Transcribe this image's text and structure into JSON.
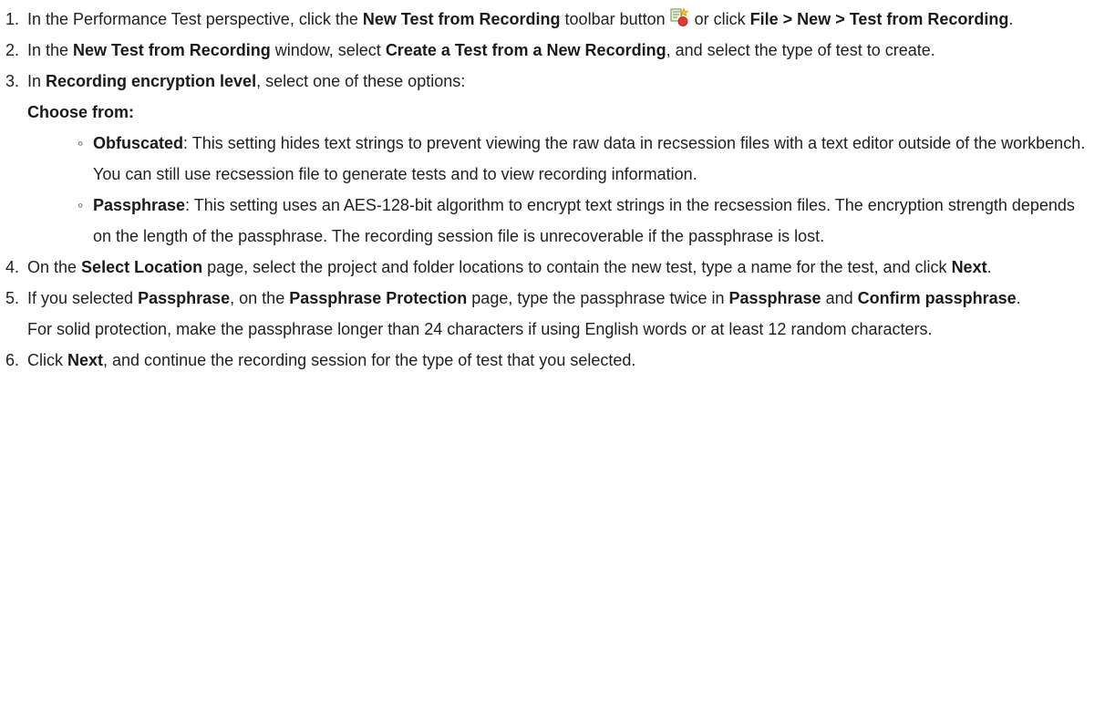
{
  "steps": [
    {
      "num": "1.",
      "a": "In the Performance Test perspective, click the ",
      "b1": "New Test from Recording",
      "c": " toolbar button ",
      "icon": "new-test-from-recording-icon",
      "d": " or click ",
      "b2": "File > New > Test from Recording",
      "e": "."
    },
    {
      "num": "2.",
      "a": "In the ",
      "b1": "New Test from Recording",
      "c": " window, select ",
      "b2": "Create a Test from a New Recording",
      "d": ", and select the type of test to create."
    },
    {
      "num": "3.",
      "a": "In ",
      "b1": "Recording encryption level",
      "c": ", select one of these options:",
      "choose": "Choose from:",
      "options": [
        {
          "term": "Obfuscated",
          "text": ": This setting hides text strings to prevent viewing the raw data in recsession files with a text editor outside of the workbench. You can still use recsession file to generate tests and to view recording information."
        },
        {
          "term": "Passphrase",
          "text": ": This setting uses an AES-128-bit algorithm to encrypt text strings in the recsession files. The encryption strength depends on the length of the passphrase. The recording session file is unrecoverable if the passphrase is lost."
        }
      ]
    },
    {
      "num": "4.",
      "a": "On the ",
      "b1": "Select Location",
      "c": " page, select the project and folder locations to contain the new test, type a name for the test, and click ",
      "b2": "Next",
      "d": "."
    },
    {
      "num": "5.",
      "a": "If you selected ",
      "b1": "Passphrase",
      "c": ", on the ",
      "b2": "Passphrase Protection",
      "d": " page, type the passphrase twice in ",
      "b3": "Passphrase",
      "e": " and ",
      "b4": "Confirm passphrase",
      "f": ".",
      "note": "For solid protection, make the passphrase longer than 24 characters if using English words or at least 12 random characters."
    },
    {
      "num": "6.",
      "a": "Click ",
      "b1": "Next",
      "c": ", and continue the recording session for the type of test that you selected."
    }
  ]
}
